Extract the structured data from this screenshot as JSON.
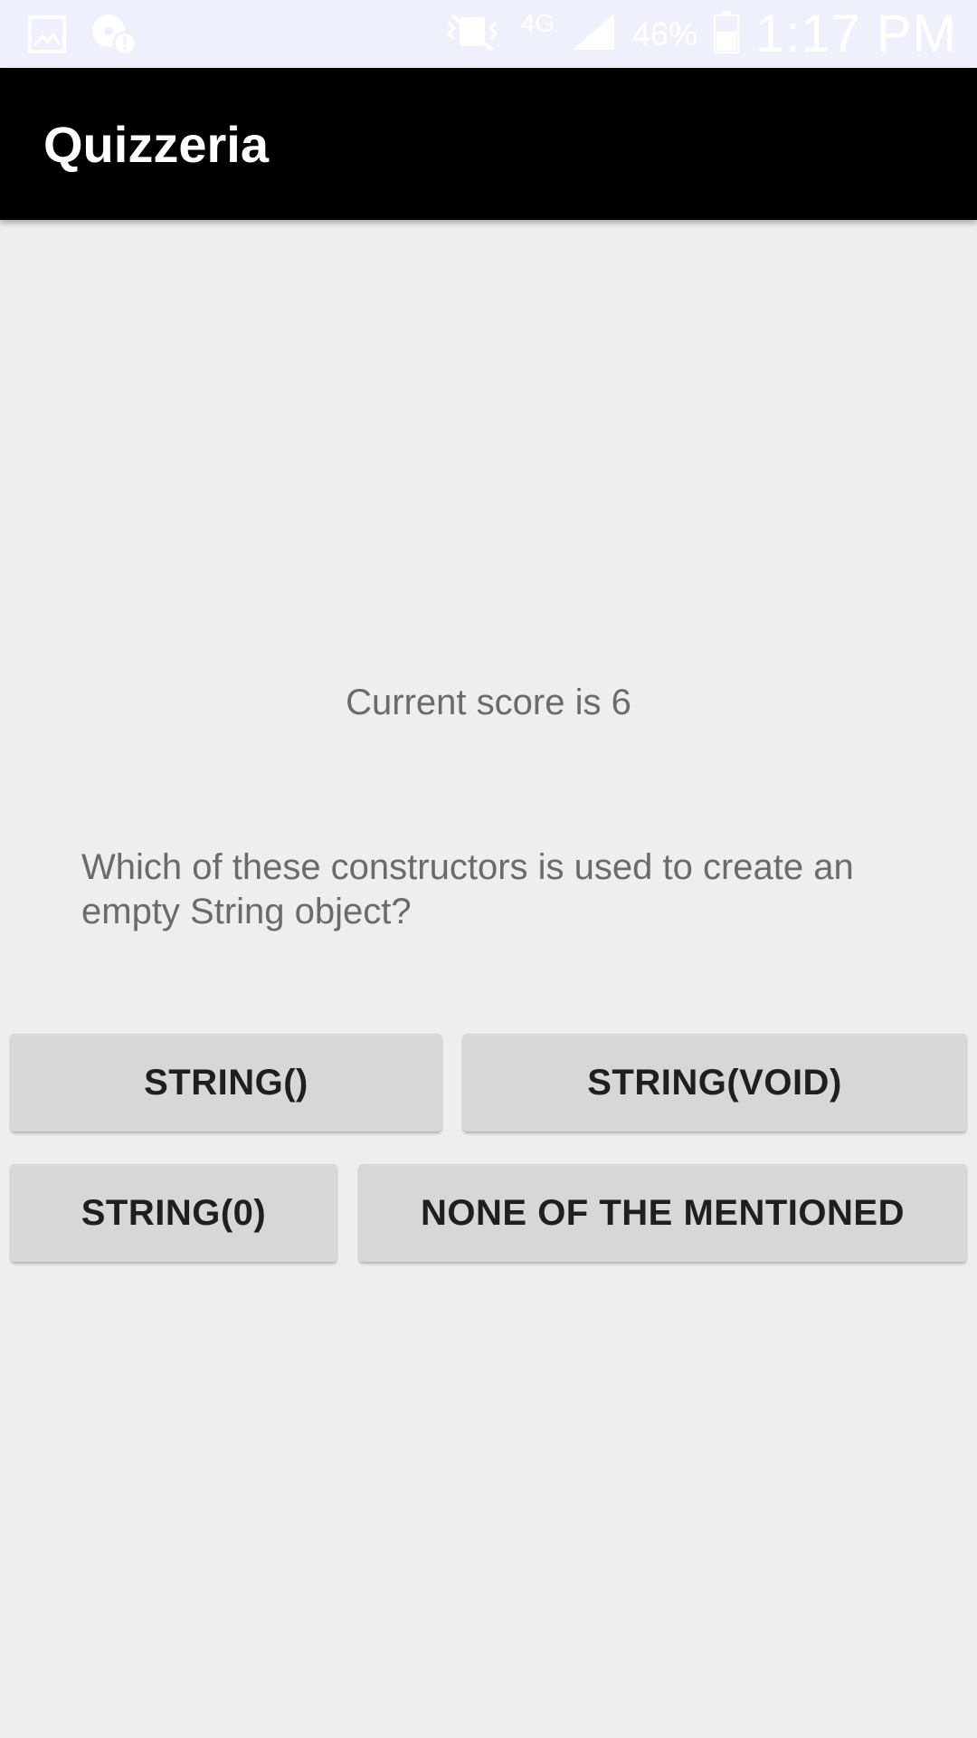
{
  "status_bar": {
    "network": "4G",
    "battery_percent": "46%",
    "time": "1:17 PM",
    "icons": [
      "gallery-icon",
      "notification-icon",
      "mute-icon",
      "signal-icon",
      "battery-icon"
    ]
  },
  "app_bar": {
    "title": "Quizzeria",
    "background": "#000000"
  },
  "quiz": {
    "score_text": "Current score is 6",
    "question": "Which of these constructors is used to create an empty String object?",
    "answers": [
      "STRING()",
      "STRING(VOID)",
      "STRING(0)",
      "NONE OF THE MENTIONED"
    ]
  }
}
